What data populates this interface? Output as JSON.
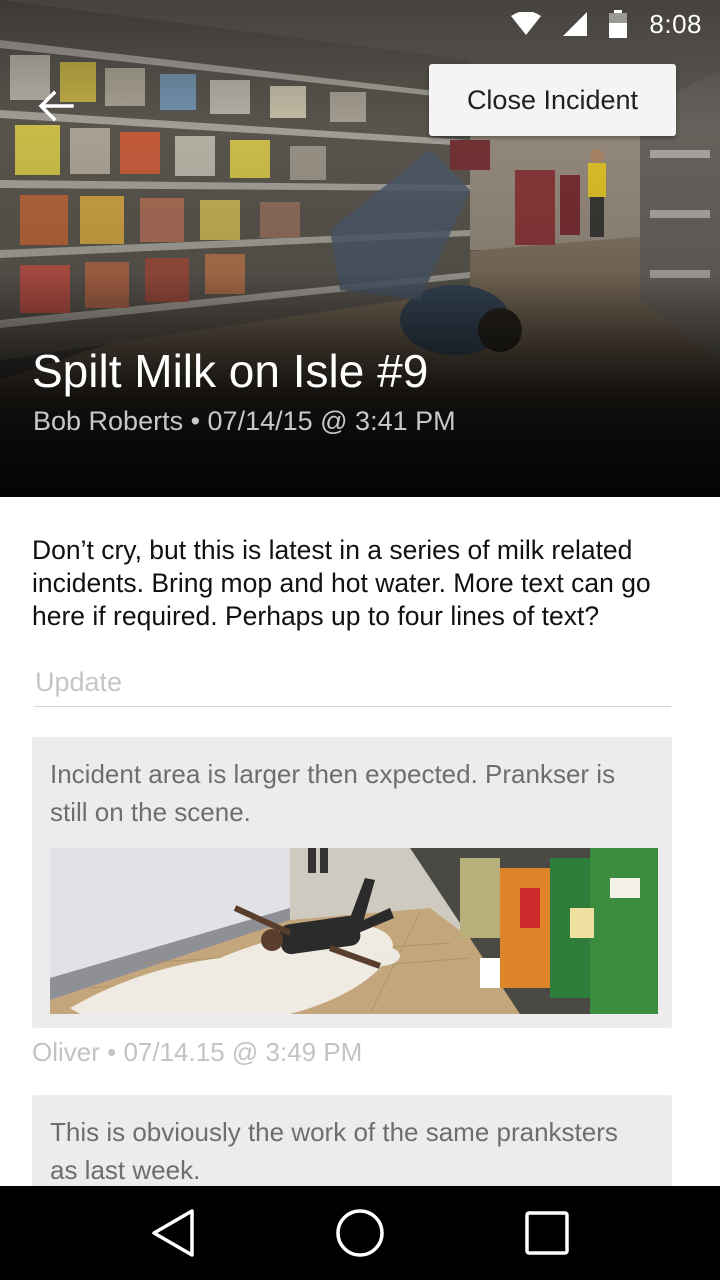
{
  "status_bar": {
    "time": "8:08",
    "icons": [
      "wifi-icon",
      "cell-signal-icon",
      "battery-icon"
    ]
  },
  "toolbar": {
    "back_icon": "arrow-left-icon",
    "close_label": "Close Incident"
  },
  "incident": {
    "title": "Spilt Milk on Isle #9",
    "meta": "Bob Roberts • 07/14/15 @ 3:41 PM",
    "description": "Don’t cry, but this is latest in a series of milk related incidents. Bring mop and hot water. More text can go here if required. Perhaps up to four lines of text?"
  },
  "update_field": {
    "placeholder": "Update",
    "value": ""
  },
  "updates": [
    {
      "text": "Incident area is larger then expected. Prankser is still on the scene.",
      "meta": "Oliver • 07/14.15 @ 3:49 PM"
    },
    {
      "text": "This is obviously the work of the same pranksters as last week."
    }
  ],
  "nav_bar": {
    "back_icon": "triangle-back-icon",
    "home_icon": "circle-home-icon",
    "recents_icon": "square-recents-icon"
  },
  "colors": {
    "accent_button_bg": "#f4f4f4",
    "card_bg": "#ececec",
    "nav_bg": "#000000"
  }
}
